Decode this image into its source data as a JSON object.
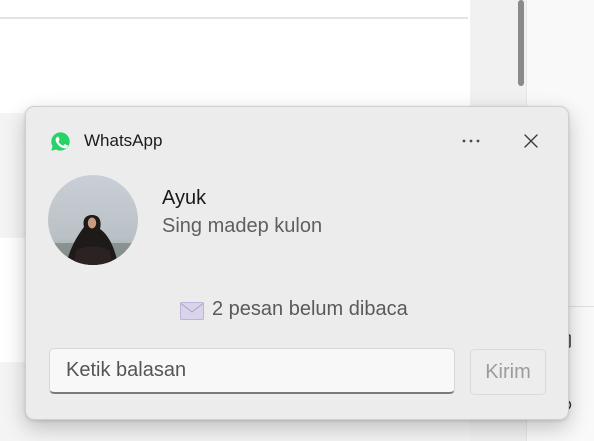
{
  "notification": {
    "app_name": "WhatsApp",
    "app_icon": "whatsapp-icon",
    "more_icon": "ellipsis-icon",
    "close_icon": "close-icon",
    "sender": "Ayuk",
    "message": "Sing madep kulon",
    "unread_icon": "envelope-icon",
    "unread_text": "2 pesan belum dibaca",
    "reply": {
      "value": "",
      "placeholder": "Ketik balasan"
    },
    "send_label": "Kirim"
  },
  "colors": {
    "whatsapp_green": "#25d366",
    "toast_bg": "#ececec",
    "send_disabled_text": "#9c9c9c"
  }
}
